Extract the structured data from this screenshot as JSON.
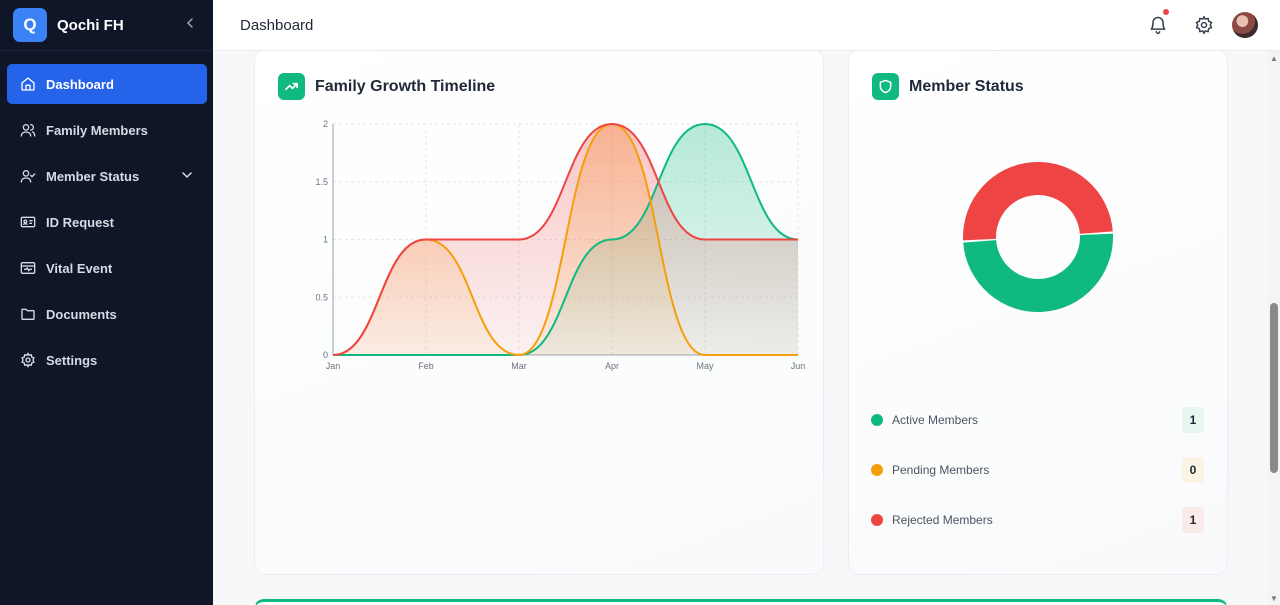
{
  "brand": {
    "logo_letter": "Q",
    "name": "Qochi FH"
  },
  "sidebar": {
    "items": [
      {
        "label": "Dashboard",
        "icon": "home-icon",
        "active": true
      },
      {
        "label": "Family Members",
        "icon": "users-icon"
      },
      {
        "label": "Member Status",
        "icon": "user-check-icon",
        "has_submenu": true
      },
      {
        "label": "ID Request",
        "icon": "id-card-icon"
      },
      {
        "label": "Vital Event",
        "icon": "vital-icon"
      },
      {
        "label": "Documents",
        "icon": "folder-icon"
      },
      {
        "label": "Settings",
        "icon": "gear-icon"
      }
    ]
  },
  "header": {
    "title": "Dashboard"
  },
  "growth_card": {
    "title": "Family Growth Timeline",
    "icon": "trending-up-icon"
  },
  "status_card": {
    "title": "Member Status",
    "icon": "shield-icon",
    "legend": [
      {
        "label": "Active Members",
        "count": "1",
        "color": "#10b981",
        "badge_bg": "#e7f6ef"
      },
      {
        "label": "Pending Members",
        "count": "0",
        "color": "#f59e0b",
        "badge_bg": "#fbf3e4"
      },
      {
        "label": "Rejected Members",
        "count": "1",
        "color": "#ef4444",
        "badge_bg": "#fbeaea"
      }
    ]
  },
  "colors": {
    "accent": "#10b981",
    "primary": "#2563eb",
    "sidebar_bg": "#0f1628"
  },
  "chart_data": [
    {
      "type": "area",
      "categories": [
        "Jan",
        "Feb",
        "Mar",
        "Apr",
        "May",
        "Jun"
      ],
      "yticks": [
        "0",
        "0.5",
        "1",
        "1.5",
        "2"
      ],
      "ylim": [
        0,
        2
      ],
      "grid": true,
      "series": [
        {
          "color": "#10b981",
          "values": [
            0,
            0,
            0,
            1,
            2,
            1
          ]
        },
        {
          "color": "#f59e0b",
          "values": [
            0,
            1,
            0,
            2,
            0,
            0
          ]
        },
        {
          "color": "#ef4444",
          "values": [
            0,
            1,
            1,
            2,
            1,
            1
          ]
        }
      ]
    },
    {
      "type": "pie",
      "values": [
        1,
        0,
        1
      ],
      "colors": [
        "#10b981",
        "#f59e0b",
        "#ef4444"
      ]
    }
  ]
}
